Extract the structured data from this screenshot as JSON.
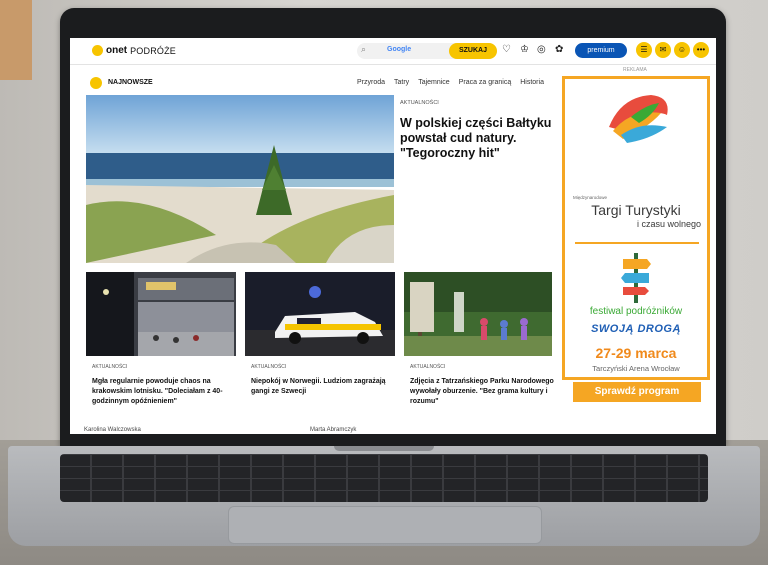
{
  "header": {
    "logo_brand": "onet",
    "logo_section": "PODRÓŻE",
    "search_powered": "Google",
    "search_button": "SZUKAJ",
    "premium_label": "premium",
    "ad_label": "REKLAMA"
  },
  "section": {
    "title": "NAJNOWSZE",
    "nav": [
      "Przyroda",
      "Tatry",
      "Tajemnice",
      "Praca za granicą",
      "Historia"
    ]
  },
  "hero": {
    "category": "AKTUALNOŚCI",
    "title": "W polskiej części Bałtyku powstał cud natury. \"Tegoroczny hit\""
  },
  "cards": [
    {
      "category": "AKTUALNOŚCI",
      "title": "Mgła regularnie powoduje chaos na krakowskim lotnisku. \"Doleciałam z 40-godzinnym opóźnieniem\""
    },
    {
      "category": "AKTUALNOŚCI",
      "title": "Niepokój w Norwegii. Ludziom zagrażają gangi ze Szwecji"
    },
    {
      "category": "AKTUALNOŚCI",
      "title": "Zdjęcia z Tatrzańskiego Parku Narodowego wywołały oburzenie. \"Bez grama kultury i rozumu\""
    }
  ],
  "authors": [
    "Karolina Walczowska",
    "Marta Abramczyk"
  ],
  "ad": {
    "small_line": "Międzynarodowe",
    "targi": "Targi Turystyki",
    "targi2": "i czasu wolnego",
    "festival": "festiwal podróżników",
    "swoja": "SWOJĄ DROGĄ",
    "dates": "27-29 marca",
    "venue": "Tarczyński Arena Wrocław",
    "button": "Sprawdź program"
  },
  "colors": {
    "accent": "#f7c400",
    "premium": "#0a55b5",
    "ad_border": "#f5a623",
    "festival_green": "#3aa935"
  }
}
